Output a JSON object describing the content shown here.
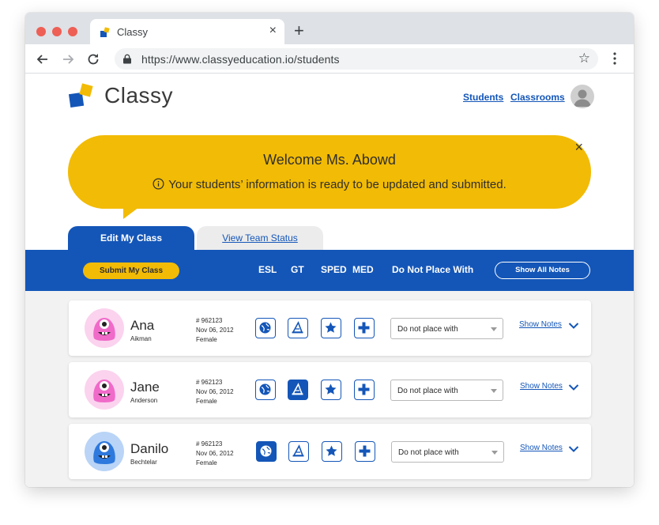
{
  "browser": {
    "tab_title": "Classy",
    "tab_close": "×",
    "new_tab": "+",
    "url": "https://www.classyeducation.io/students",
    "bookmark_star": "☆"
  },
  "header": {
    "brand": "Classy",
    "links": [
      "Students",
      "Classrooms"
    ]
  },
  "banner": {
    "close": "×",
    "title": "Welcome Ms. Abowd",
    "message": "Your students’ information is ready to be updated and submitted."
  },
  "tabs": {
    "active": "Edit My Class",
    "inactive": "View Team Status"
  },
  "toolbar": {
    "submit_label": "Submit My Class",
    "columns": [
      "ESL",
      "GT",
      "SPED",
      "MED",
      "Do Not Place With"
    ],
    "show_all_notes": "Show All Notes"
  },
  "students": [
    {
      "first": "Ana",
      "last": "Aikman",
      "id": "# 962123",
      "dob": "Nov 06, 2012",
      "gender": "Female",
      "avatar": "pink-monster-icon",
      "esl": false,
      "gt": false,
      "sped": false,
      "med": false,
      "placement": "Do not place with",
      "notes_label": "Show Notes"
    },
    {
      "first": "Jane",
      "last": "Anderson",
      "id": "# 962123",
      "dob": "Nov 06, 2012",
      "gender": "Female",
      "avatar": "pink-monster-icon",
      "esl": false,
      "gt": true,
      "sped": false,
      "med": false,
      "placement": "Do not place with",
      "notes_label": "Show Notes"
    },
    {
      "first": "Danilo",
      "last": "Bechtelar",
      "id": "# 962123",
      "dob": "Nov 06, 2012",
      "gender": "Female",
      "avatar": "blue-monster-icon",
      "esl": true,
      "gt": false,
      "sped": false,
      "med": false,
      "placement": "Do not place with",
      "notes_label": "Show Notes"
    }
  ],
  "colors": {
    "primary_blue": "#1456b8",
    "accent_yellow": "#f2bb05",
    "pink_monster": "#f06ac9",
    "blue_monster": "#2e79dd"
  }
}
